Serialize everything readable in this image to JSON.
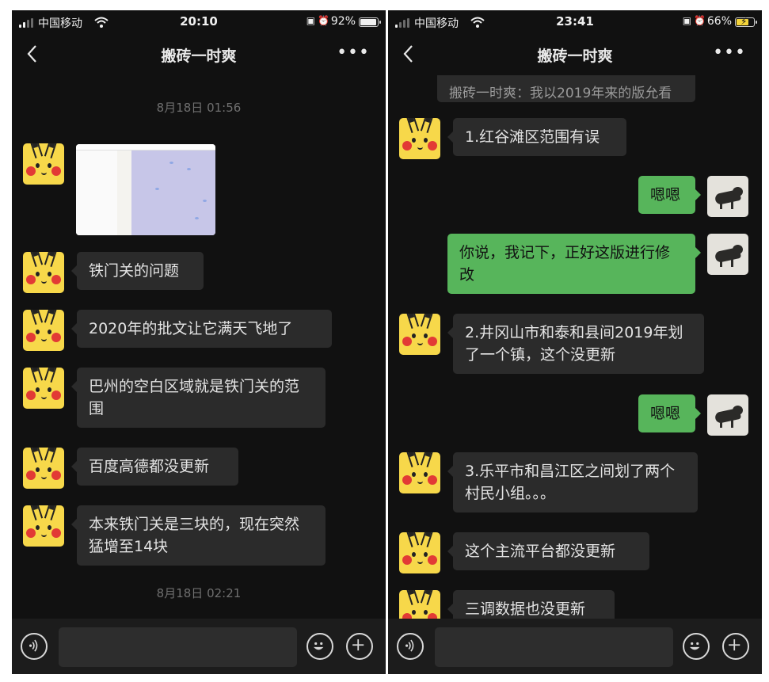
{
  "left": {
    "status": {
      "carrier": "中国移动",
      "time": "20:10",
      "battery": "92%",
      "battery_level": 0.92
    },
    "header": {
      "title": "搬砖一时爽"
    },
    "messages": [
      {
        "text": "8月18日 01:56"
      },
      {
        "text": "铁门关的问题"
      },
      {
        "text": "2020年的批文让它满天飞地了"
      },
      {
        "text": "巴州的空白区域就是铁门关的范围"
      },
      {
        "text": "百度高德都没更新"
      },
      {
        "text": "本来铁门关是三块的，现在突然猛增至14块"
      },
      {
        "text": "8月18日 02:21"
      }
    ]
  },
  "right": {
    "status": {
      "carrier": "中国移动",
      "time": "23:41",
      "battery": "66%",
      "battery_level": 0.66
    },
    "header": {
      "title": "搬砖一时爽"
    },
    "messages": [
      {
        "text": "搬砖一时爽：我以2019年来的版允看"
      },
      {
        "text": "1.红谷滩区范围有误"
      },
      {
        "text": "嗯嗯"
      },
      {
        "text": "你说，我记下，正好这版进行修改"
      },
      {
        "text": "2.井冈山市和泰和县间2019年划了一个镇，这个没更新"
      },
      {
        "text": "嗯嗯"
      },
      {
        "text": "3.乐平市和昌江区之间划了两个村民小组。。。"
      },
      {
        "text": "这个主流平台都没更新"
      },
      {
        "text": "三调数据也没更新"
      }
    ]
  },
  "icons": {
    "back": "chevron-left-icon",
    "more": "more-dots-icon",
    "voice": "voice-icon",
    "emoji": "emoji-icon",
    "plus": "plus-icon"
  },
  "colors": {
    "background": "#111111",
    "bubble_other": "#2b2b2b",
    "bubble_self": "#57b55b",
    "input_bar": "#1c1c1c"
  }
}
